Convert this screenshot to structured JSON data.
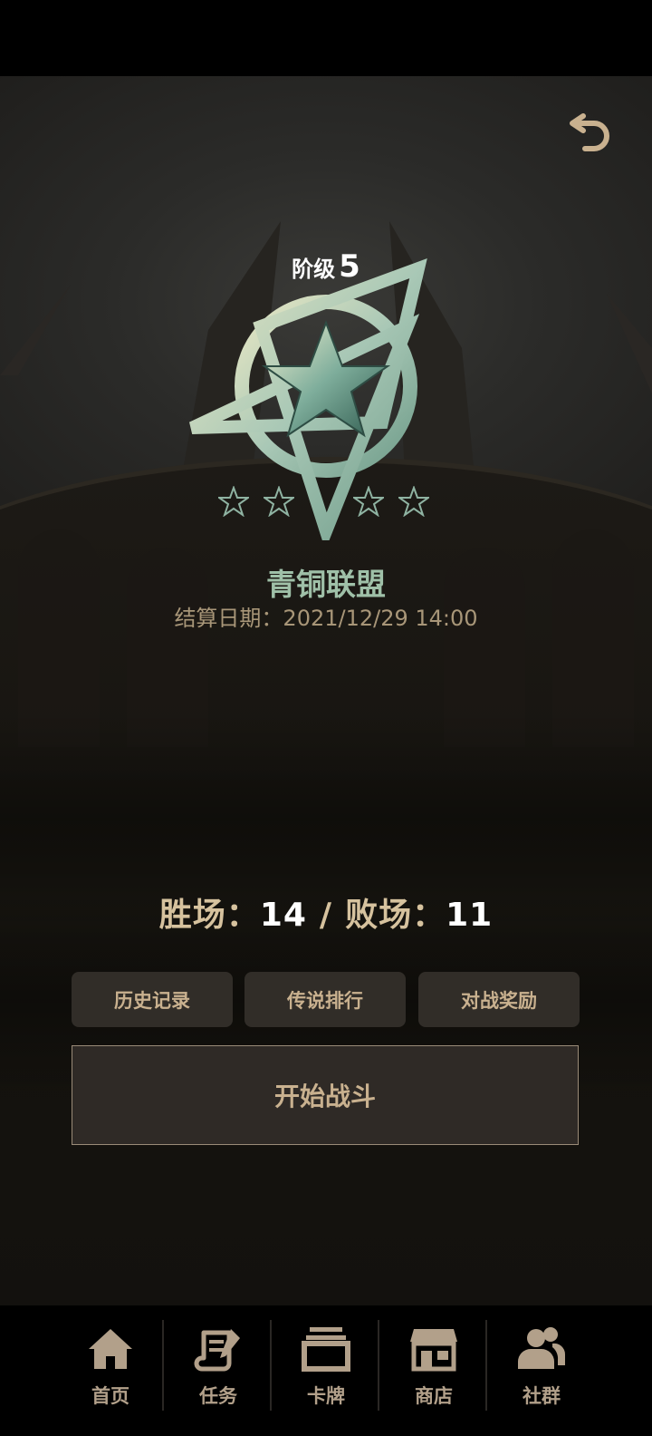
{
  "rank": {
    "label": "阶级",
    "level": "5",
    "stars_total": 4
  },
  "league": {
    "name": "青铜联盟",
    "settlement": "结算日期：2021/12/29 14:00"
  },
  "record": {
    "wins_label": "胜场：",
    "wins": "14",
    "separator": "/",
    "losses_label": "败场：",
    "losses": "11"
  },
  "buttons": {
    "history": "历史记录",
    "legend_rank": "传说排行",
    "battle_rewards": "对战奖励",
    "start_battle": "开始战斗"
  },
  "nav": {
    "items": [
      {
        "label": "首页",
        "icon": "home-icon"
      },
      {
        "label": "任务",
        "icon": "task-scroll-icon"
      },
      {
        "label": "卡牌",
        "icon": "cards-icon"
      },
      {
        "label": "商店",
        "icon": "shop-icon"
      },
      {
        "label": "社群",
        "icon": "community-icon"
      }
    ]
  },
  "colors": {
    "accent": "#c9b18f",
    "league_green": "#9fc0a8",
    "button_bg": "#312d28"
  }
}
